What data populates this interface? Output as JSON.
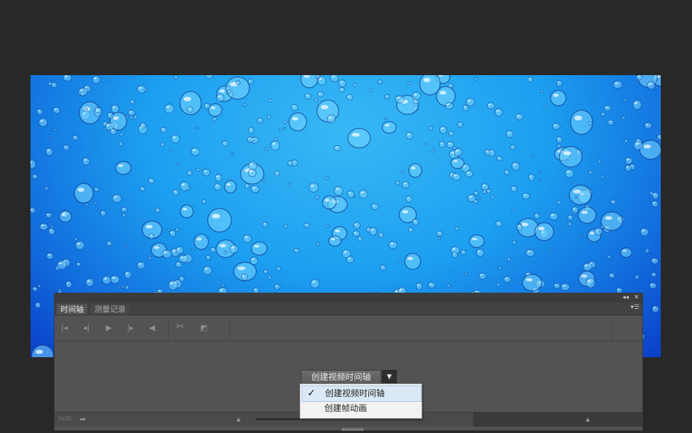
{
  "panel": {
    "tabs": [
      {
        "label": "时间轴",
        "active": true
      },
      {
        "label": "测量记录",
        "active": false
      }
    ],
    "controls": {
      "collapse_icon": "double-chevron-left-icon",
      "close_icon": "close-icon",
      "menu_icon": "panel-menu-icon"
    },
    "toolbar_icons": [
      "first-frame-icon",
      "previous-frame-icon",
      "play-icon",
      "next-frame-icon",
      "audio-icon",
      "split-scissors-icon",
      "transition-icon"
    ],
    "create_button": {
      "label": "创建视频时间轴"
    },
    "dropdown": {
      "items": [
        {
          "label": "创建视频时间轴",
          "checked": true
        },
        {
          "label": "创建帧动画",
          "checked": false
        }
      ]
    },
    "bottom_icons": [
      "convert-frames-icon",
      "render-video-icon",
      "zoom-slider-icon"
    ]
  },
  "colors": {
    "app_bg": "#282828",
    "panel_bg": "#535353",
    "canvas_top": "#38b8f5",
    "canvas_bottom": "#0a3ec9",
    "menu_highlight": "#dbe8f6"
  }
}
